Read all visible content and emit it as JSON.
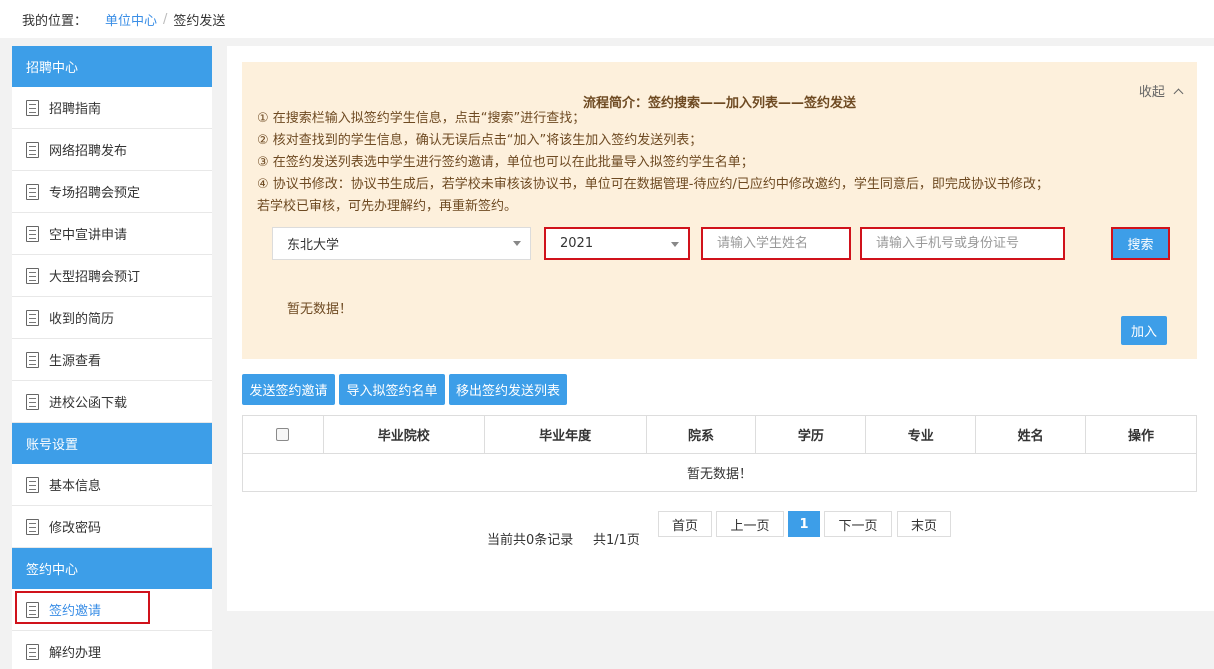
{
  "breadcrumb": {
    "label": "我的位置：",
    "link": "单位中心",
    "separator": "/",
    "current": "签约发送"
  },
  "sidebar": {
    "sections": [
      {
        "title": "招聘中心",
        "items": [
          "招聘指南",
          "网络招聘发布",
          "专场招聘会预定",
          "空中宣讲申请",
          "大型招聘会预订",
          "收到的简历",
          "生源查看",
          "进校公函下载"
        ]
      },
      {
        "title": "账号设置",
        "items": [
          "基本信息",
          "修改密码"
        ]
      },
      {
        "title": "签约中心",
        "items": [
          "签约邀请",
          "解约办理"
        ]
      }
    ]
  },
  "flow": {
    "title": "流程简介：签约搜索——加入列表——签约发送",
    "collapse_label": "收起",
    "steps": [
      "① 在搜索栏输入拟签约学生信息，点击“搜索”进行查找；",
      "② 核对查找到的学生信息，确认无误后点击“加入”将该生加入签约发送列表；",
      "③ 在签约发送列表选中学生进行签约邀请，单位也可以在此批量导入拟签约学生名单；",
      "④ 协议书修改：协议书生成后，若学校未审核该协议书，单位可在数据管理-待应约/已应约中修改邀约，学生同意后，即完成协议书修改；",
      "若学校已审核，可先办理解约，再重新签约。"
    ],
    "school_select": "东北大学",
    "year_select": "2021",
    "name_placeholder": "请输入学生姓名",
    "id_placeholder": "请输入手机号或身份证号",
    "search_button": "搜索",
    "no_data": "暂无数据！",
    "add_button": "加入"
  },
  "actions": {
    "send_invite": "发送签约邀请",
    "import_list": "导入拟签约名单",
    "remove_list": "移出签约发送列表"
  },
  "table": {
    "columns": [
      "毕业院校",
      "毕业年度",
      "院系",
      "学历",
      "专业",
      "姓名",
      "操作"
    ],
    "empty_text": "暂无数据！"
  },
  "pagination": {
    "summary": "当前共0条记录",
    "pages": "共1/1页",
    "first": "首页",
    "prev": "上一页",
    "current": "1",
    "next": "下一页",
    "last": "末页"
  },
  "colors": {
    "accent": "#3d9ee8",
    "highlight": "#d0121b",
    "notice_bg": "#fdf0dc"
  }
}
